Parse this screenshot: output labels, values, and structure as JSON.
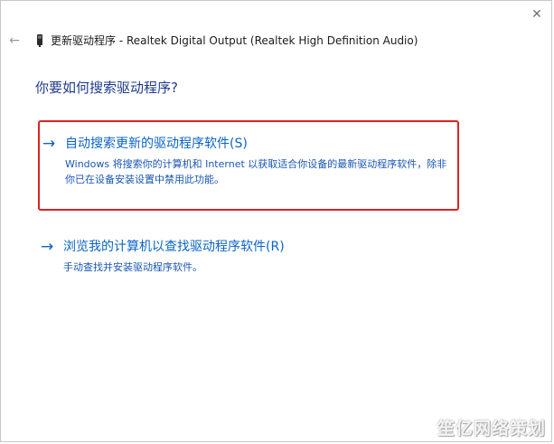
{
  "window": {
    "title": "更新驱动程序 - Realtek Digital Output (Realtek High Definition Audio)",
    "back_icon": "back-arrow-icon",
    "close_icon": "close-icon",
    "close_glyph": "✕",
    "back_glyph": "←"
  },
  "main": {
    "question": "你要如何搜索驱动程序?",
    "options": [
      {
        "arrow": "→",
        "label": "自动搜索更新的驱动程序软件(S)",
        "description": "Windows 将搜索你的计算机和 Internet 以获取适合你设备的最新驱动程序软件，除非你已在设备安装设置中禁用此功能。"
      },
      {
        "arrow": "→",
        "label": "浏览我的计算机以查找驱动程序软件(R)",
        "description": "手动查找并安装驱动程序软件。"
      }
    ]
  },
  "colors": {
    "link": "#0a64c8",
    "heading": "#1f3b8a",
    "highlight_border": "#e02020"
  },
  "watermark": {
    "text": "笙亿网络策划"
  }
}
